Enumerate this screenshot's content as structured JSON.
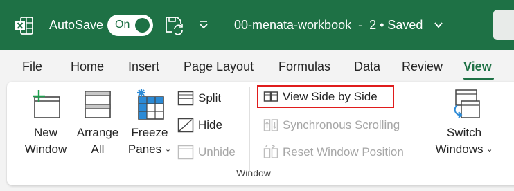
{
  "titlebar": {
    "app_icon": "excel-logo-icon",
    "autosave_label": "AutoSave",
    "autosave_state": "On",
    "save_icon": "save-sync-icon",
    "qat_more_icon": "customize-qat-icon",
    "document_title": "00-menata-workbook  -  2 • Saved",
    "title_chevron": "chevron-down-icon",
    "colors": {
      "bar": "#1e7145",
      "text": "#ffffff"
    }
  },
  "tabs": [
    {
      "label": "File"
    },
    {
      "label": "Home"
    },
    {
      "label": "Insert"
    },
    {
      "label": "Page Layout"
    },
    {
      "label": "Formulas"
    },
    {
      "label": "Data"
    },
    {
      "label": "Review"
    },
    {
      "label": "View",
      "active": true
    }
  ],
  "ribbon": {
    "group_label": "Window",
    "new_window": {
      "line1": "New",
      "line2": "Window",
      "icon": "new-window-icon"
    },
    "arrange_all": {
      "line1": "Arrange",
      "line2": "All",
      "icon": "arrange-all-icon"
    },
    "freeze_panes": {
      "line1": "Freeze",
      "line2": "Panes",
      "icon": "freeze-panes-icon"
    },
    "split": {
      "label": "Split",
      "icon": "split-icon"
    },
    "hide": {
      "label": "Hide",
      "icon": "hide-icon"
    },
    "unhide": {
      "label": "Unhide",
      "icon": "unhide-icon",
      "disabled": true
    },
    "view_side_by_side": {
      "label": "View Side by Side",
      "icon": "view-side-by-side-icon",
      "highlighted": true
    },
    "synchronous_scrolling": {
      "label": "Synchronous Scrolling",
      "icon": "synchronous-scrolling-icon",
      "disabled": true
    },
    "reset_window_position": {
      "label": "Reset Window Position",
      "icon": "reset-window-position-icon",
      "disabled": true
    },
    "switch_windows": {
      "line1": "Switch",
      "line2": "Windows",
      "icon": "switch-windows-icon"
    },
    "colors": {
      "accent": "#1e7145",
      "highlight": "#e01c1c",
      "disabled": "#a6a6a6"
    }
  }
}
